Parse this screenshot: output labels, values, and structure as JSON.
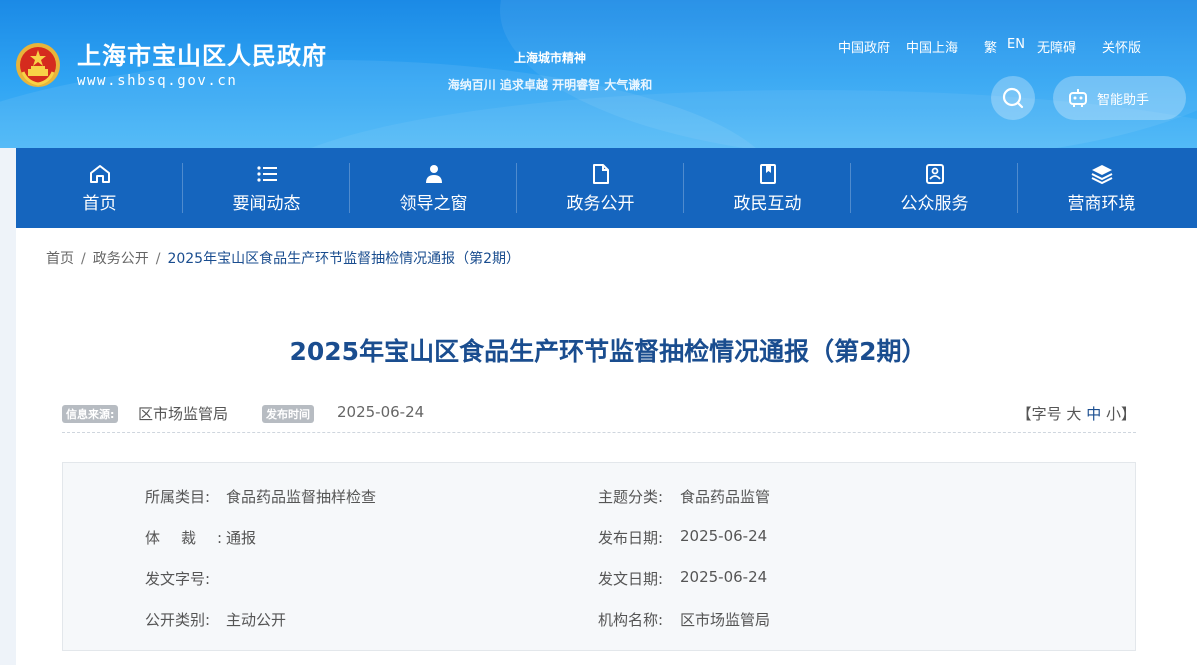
{
  "header": {
    "site_name": "上海市宝山区人民政府",
    "site_domain": "www.shbsq.gov.cn",
    "slogan_title": "上海城市精神",
    "slogan_text": "海纳百川 追求卓越 开明睿智 大气谦和",
    "top_links": [
      "中国政府",
      "中国上海",
      "繁",
      "EN",
      "无障碍",
      "关怀版"
    ],
    "assistant_label": "智能助手"
  },
  "nav": {
    "items": [
      {
        "label": "首页",
        "icon": "home-icon"
      },
      {
        "label": "要闻动态",
        "icon": "list-icon"
      },
      {
        "label": "领导之窗",
        "icon": "person-icon"
      },
      {
        "label": "政务公开",
        "icon": "document-icon"
      },
      {
        "label": "政民互动",
        "icon": "bookmark-icon"
      },
      {
        "label": "公众服务",
        "icon": "service-icon"
      },
      {
        "label": "营商环境",
        "icon": "layers-icon"
      }
    ]
  },
  "breadcrumb": {
    "items": [
      "首页",
      "政务公开",
      "2025年宝山区食品生产环节监督抽检情况通报（第2期）"
    ],
    "separator": "/"
  },
  "article": {
    "title": "2025年宝山区食品生产环节监督抽检情况通报（第2期）",
    "source_label": "信息来源:",
    "source_value": "区市场监管局",
    "date_label": "发布时间",
    "date_value": "2025-06-24",
    "fontsize_open": "【字号",
    "fontsize_large": "大",
    "fontsize_medium": "中",
    "fontsize_small": "小】"
  },
  "info": {
    "category_label": "所属类目:",
    "category_value": "食品药品监督抽样检查",
    "topic_label": "主题分类:",
    "topic_value": "食品药品监管",
    "genre_label": "体裁:",
    "genre_value": "通报",
    "pub_date_label": "发布日期:",
    "pub_date_value": "2025-06-24",
    "doc_no_label": "发文字号:",
    "doc_no_value": "",
    "doc_date_label": "发文日期:",
    "doc_date_value": "2025-06-24",
    "open_type_label": "公开类别:",
    "open_type_value": "主动公开",
    "org_label": "机构名称:",
    "org_value": "区市场监管局"
  },
  "colors": {
    "header_blue": "#2fa4f3",
    "nav_blue": "#1565be",
    "title_blue": "#1a4d8f",
    "tag_gray": "#b7bcc2"
  }
}
